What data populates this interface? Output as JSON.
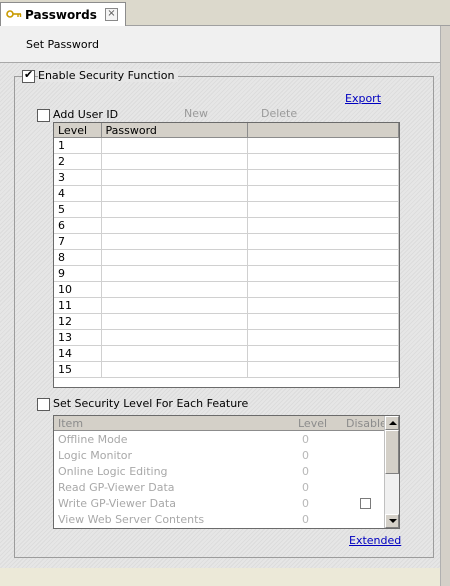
{
  "tab": {
    "title": "Passwords",
    "close_glyph": "×",
    "icon": "key-icon"
  },
  "header": {
    "title": "Set Password"
  },
  "security": {
    "enable_label": "Enable Security Function",
    "enable_checked": true,
    "export_label": "Export"
  },
  "user_id": {
    "add_label": "Add User ID",
    "add_checked": false,
    "new_label": "New",
    "delete_label": "Delete",
    "columns": [
      "Level",
      "Password",
      ""
    ],
    "rows": [
      "1",
      "2",
      "3",
      "4",
      "5",
      "6",
      "7",
      "8",
      "9",
      "10",
      "11",
      "12",
      "13",
      "14",
      "15"
    ]
  },
  "features": {
    "set_label": "Set Security Level For Each Feature",
    "set_checked": false,
    "columns": [
      "Item",
      "Level",
      "Disable"
    ],
    "rows": [
      {
        "item": "Offline Mode",
        "level": "0",
        "disable": false
      },
      {
        "item": "Logic Monitor",
        "level": "0",
        "disable": false
      },
      {
        "item": "Online Logic Editing",
        "level": "0",
        "disable": false
      },
      {
        "item": "Read GP-Viewer Data",
        "level": "0",
        "disable": false
      },
      {
        "item": "Write GP-Viewer Data",
        "level": "0",
        "disable": true
      },
      {
        "item": "View Web Server Contents",
        "level": "0",
        "disable": false
      }
    ],
    "extended_label": "Extended"
  },
  "colors": {
    "link": "#0000c0",
    "disabled_text": "#a8a8a8",
    "panel_hatch": "#e6e6e6"
  }
}
